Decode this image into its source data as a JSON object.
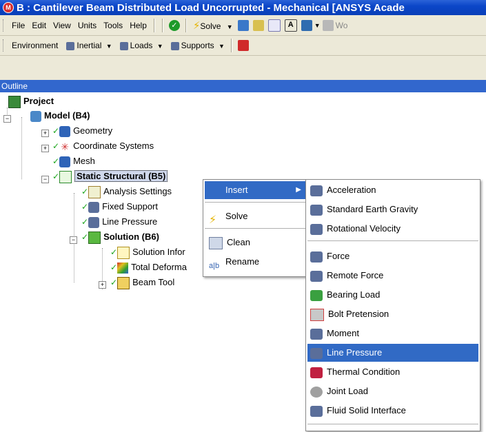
{
  "window": {
    "title": "B : Cantilever Beam Distributed Load Uncorrupted - Mechanical [ANSYS Acade"
  },
  "menubar": {
    "items": [
      "File",
      "Edit",
      "View",
      "Units",
      "Tools",
      "Help"
    ],
    "solve_label": "Solve",
    "worksheet_label": "Wo"
  },
  "toolbar2": {
    "environment_label": "Environment",
    "inertial_label": "Inertial",
    "loads_label": "Loads",
    "supports_label": "Supports"
  },
  "outline": {
    "header": "Outline"
  },
  "tree": {
    "project": "Project",
    "model": "Model (B4)",
    "geometry": "Geometry",
    "coordinate_systems": "Coordinate Systems",
    "mesh": "Mesh",
    "static_structural": "Static Structural (B5)",
    "analysis_settings": "Analysis Settings",
    "fixed_support": "Fixed Support",
    "line_pressure": "Line Pressure",
    "solution": "Solution (B6)",
    "solution_information": "Solution Infor",
    "total_deformation": "Total Deforma",
    "beam_tool": "Beam Tool"
  },
  "context_menu": {
    "insert": "Insert",
    "solve": "Solve",
    "clean": "Clean",
    "rename": "Rename"
  },
  "submenu": {
    "acceleration": "Acceleration",
    "standard_earth_gravity": "Standard Earth Gravity",
    "rotational_velocity": "Rotational Velocity",
    "force": "Force",
    "remote_force": "Remote Force",
    "bearing_load": "Bearing Load",
    "bolt_pretension": "Bolt Pretension",
    "moment": "Moment",
    "line_pressure": "Line Pressure",
    "thermal_condition": "Thermal Condition",
    "joint_load": "Joint Load",
    "fluid_solid_interface": "Fluid Solid Interface"
  },
  "colors": {
    "selection": "#316ac5",
    "titlebar": "#0b46c8",
    "outline_header": "#3267cd"
  }
}
